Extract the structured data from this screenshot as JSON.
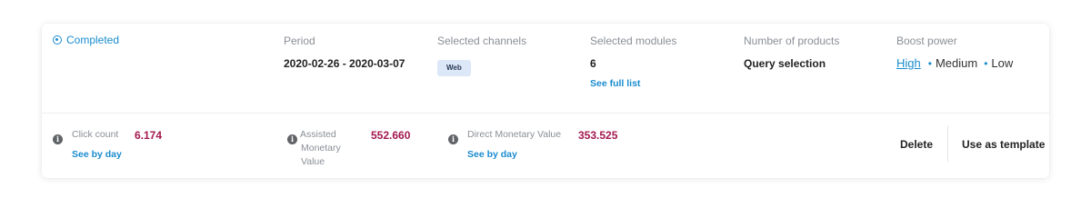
{
  "campaign": {
    "status": "Completed",
    "period": {
      "label": "Period",
      "value": "2020-02-26 - 2020-03-07"
    },
    "channels": {
      "label": "Selected channels",
      "items": [
        "Web"
      ]
    },
    "modules": {
      "label": "Selected modules",
      "count": "6",
      "link": "See full list"
    },
    "products": {
      "label": "Number of products",
      "value": "Query selection"
    },
    "boost": {
      "label": "Boost power",
      "options": [
        "High",
        "Medium",
        "Low"
      ],
      "selected": "High"
    }
  },
  "metrics": {
    "click_count": {
      "label": "Click count",
      "value": "6.174",
      "link": "See by day"
    },
    "assisted": {
      "label_lines": [
        "Assisted",
        "Monetary",
        "Value"
      ],
      "value": "552.660"
    },
    "direct": {
      "label": "Direct Monetary Value",
      "value": "353.525",
      "link": "See by day"
    }
  },
  "actions": {
    "delete": "Delete",
    "template": "Use as template"
  },
  "colors": {
    "accent": "#1a8ccf",
    "metric": "#a3184f",
    "chip_bg": "#dce8f7"
  },
  "icons": {
    "status": "radio-dot-icon",
    "info": "info-icon"
  }
}
